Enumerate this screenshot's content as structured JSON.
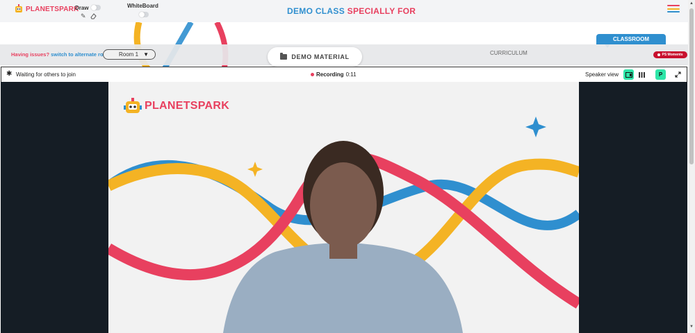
{
  "header": {
    "brand": "PLANETSPARK",
    "draw_label": "Draw",
    "whiteboard_label": "WhiteBoard",
    "title_part1": "DEMO CLASS",
    "title_part2": "SPECIALLY FOR",
    "menu_icon": "hamburger-icon",
    "pencil_icon": "pencil-icon",
    "eraser_icon": "eraser-icon"
  },
  "nav": {
    "issues_text": "Having issues?",
    "switch_link": "switch to alternate room",
    "room_selected": "Room 1",
    "demo_material": "DEMO MATERIAL",
    "curriculum": "CURRICULUM",
    "classroom_tab": "CLASSROOM",
    "ps_moments": "PS Moments"
  },
  "video_toolbar": {
    "waiting_text": "Waiting for others to join",
    "recording_label": "Recording",
    "recording_time": "0:11",
    "view_mode": "Speaker view",
    "participant_initial": "P"
  },
  "slide": {
    "brand": "PLANETSPARK"
  },
  "colors": {
    "brand_red": "#e8405f",
    "brand_blue": "#2f8fcf",
    "brand_yellow": "#f4b324",
    "accent_green": "#2ee6a8"
  }
}
